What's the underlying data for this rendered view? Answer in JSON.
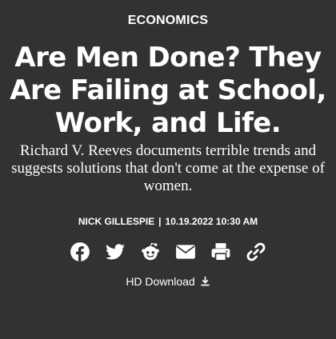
{
  "article": {
    "category": "ECONOMICS",
    "headline": "Are Men Done? They Are Failing at School, Work, and Life.",
    "dek": "Richard V. Reeves documents terrible trends and suggests solutions that don't come at the expense of women.",
    "author": "NICK GILLESPIE",
    "separator": "|",
    "datetime": "10.19.2022 10:30 AM"
  },
  "share": {
    "icons": [
      "facebook-icon",
      "twitter-icon",
      "reddit-icon",
      "email-icon",
      "print-icon",
      "link-icon"
    ]
  },
  "download": {
    "label": "HD Download",
    "icon": "download-icon"
  },
  "colors": {
    "background": "#323232",
    "text": "#ffffff"
  }
}
